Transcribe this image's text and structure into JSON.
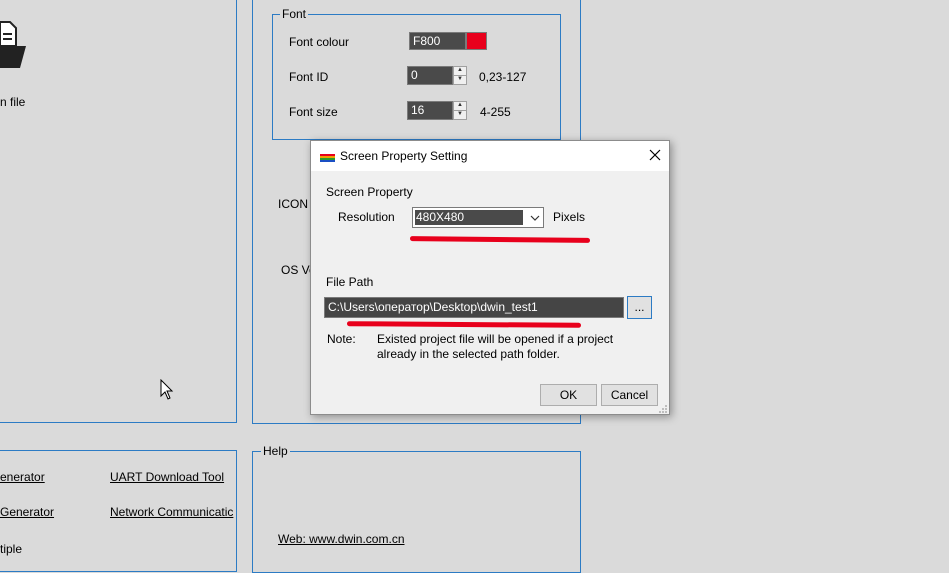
{
  "left_panel": {
    "open_file_label": "n file"
  },
  "font_group": {
    "title": "Font",
    "font_colour_label": "Font colour",
    "font_colour_value": "F800",
    "font_colour_swatch": "#e8001c",
    "font_id_label": "Font ID",
    "font_id_value": "0",
    "font_id_range": "0,23-127",
    "font_size_label": "Font size",
    "font_size_value": "16",
    "font_size_range": "4-255"
  },
  "mid_labels": {
    "icon": "ICON",
    "os_version": "OS Ve"
  },
  "tools": {
    "generator1": "enerator",
    "generator2": "Generator",
    "multiple": "tiple",
    "uart": "UART Download Tool",
    "network": "Network Communicatic"
  },
  "help_group": {
    "title": "Help",
    "web_link": "Web: www.dwin.com.cn"
  },
  "dialog": {
    "title": "Screen Property Setting",
    "screen_property_label": "Screen Property",
    "resolution_label": "Resolution",
    "resolution_value": "480X480",
    "pixels_label": "Pixels",
    "file_path_label": "File Path",
    "file_path_value": "C:\\Users\\оператор\\Desktop\\dwin_test1",
    "browse_label": "...",
    "note_label": "Note:",
    "note_text": "Existed project file will be opened if a project already in the selected path folder.",
    "ok_label": "OK",
    "cancel_label": "Cancel"
  },
  "annotation_color": "#e8001c"
}
